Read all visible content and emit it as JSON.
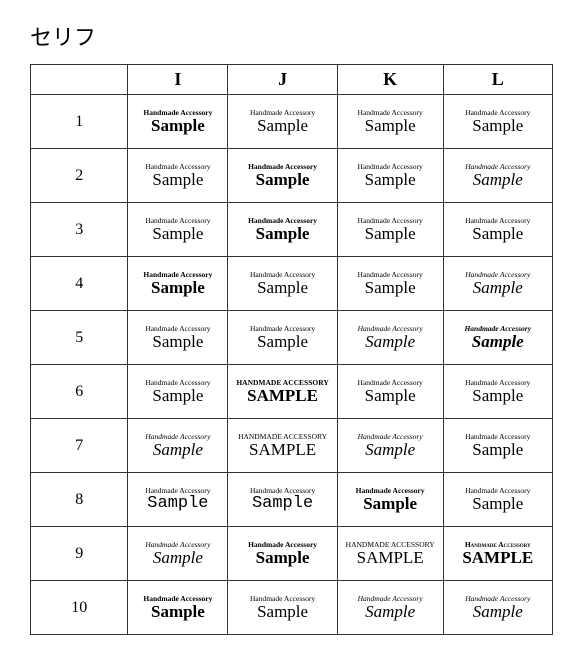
{
  "title": "セリフ",
  "columns": [
    "",
    "I",
    "J",
    "K",
    "L"
  ],
  "rows": [
    {
      "num": "1",
      "cells": [
        {
          "top": "Handmade Accessory",
          "bottom": "Sample",
          "topStyle": "r1i-top",
          "bottomStyle": "r1i-bottom"
        },
        {
          "top": "Handmade Accessory",
          "bottom": "Sample",
          "topStyle": "v-normal",
          "bottomStyle": "v-normal"
        },
        {
          "top": "Handmade Accessory",
          "bottom": "Sample",
          "topStyle": "v-normal",
          "bottomStyle": "v-normal"
        },
        {
          "top": "Handmade Accessory",
          "bottom": "Sample",
          "topStyle": "v-normal",
          "bottomStyle": "v-normal"
        }
      ]
    },
    {
      "num": "2",
      "cells": [
        {
          "top": "Handmade Accessory",
          "bottom": "Sample",
          "topStyle": "v-normal",
          "bottomStyle": "v-normal"
        },
        {
          "top": "Handmade Accessory",
          "bottom": "Sample",
          "topStyle": "v-bold",
          "bottomStyle": "v-bold"
        },
        {
          "top": "Handmade Accessory",
          "bottom": "Sample",
          "topStyle": "v-normal",
          "bottomStyle": "v-normal"
        },
        {
          "top": "Handmade Accessory",
          "bottom": "Sample",
          "topStyle": "v-italic",
          "bottomStyle": "v-italic"
        }
      ]
    },
    {
      "num": "3",
      "cells": [
        {
          "top": "Handmade Accessory",
          "bottom": "Sample",
          "topStyle": "v-normal",
          "bottomStyle": "v-normal"
        },
        {
          "top": "Handmade Accessory",
          "bottom": "Sample",
          "topStyle": "v-bold",
          "bottomStyle": "v-bold"
        },
        {
          "top": "Handmade Accessory",
          "bottom": "Sample",
          "topStyle": "v-normal",
          "bottomStyle": "v-normal"
        },
        {
          "top": "Handmade Accessory",
          "bottom": "Sample",
          "topStyle": "v-normal",
          "bottomStyle": "v-normal"
        }
      ]
    },
    {
      "num": "4",
      "cells": [
        {
          "top": "Handmade Accessory",
          "bottom": "Sample",
          "topStyle": "v-bold",
          "bottomStyle": "v-bold"
        },
        {
          "top": "Handmade Accessory",
          "bottom": "Sample",
          "topStyle": "v-normal",
          "bottomStyle": "v-normal"
        },
        {
          "top": "Handmade Accessory",
          "bottom": "Sample",
          "topStyle": "v-normal",
          "bottomStyle": "v-normal"
        },
        {
          "top": "Handmade Accessory",
          "bottom": "Sample",
          "topStyle": "v-script",
          "bottomStyle": "v-script"
        }
      ]
    },
    {
      "num": "5",
      "cells": [
        {
          "top": "Handmade Accessory",
          "bottom": "Sample",
          "topStyle": "v-normal",
          "bottomStyle": "v-normal"
        },
        {
          "top": "Handmade Accessory",
          "bottom": "Sample",
          "topStyle": "v-normal",
          "bottomStyle": "v-normal"
        },
        {
          "top": "Handmade Accessory",
          "bottom": "Sample",
          "topStyle": "v-script",
          "bottomStyle": "v-script"
        },
        {
          "top": "Handmade Accessory",
          "bottom": "Sample",
          "topStyle": "v-script-bold",
          "bottomStyle": "v-script-bold"
        }
      ]
    },
    {
      "num": "6",
      "cells": [
        {
          "top": "Handmade Accessory",
          "bottom": "Sample",
          "topStyle": "v-normal",
          "bottomStyle": "v-normal"
        },
        {
          "top": "HANDMADE ACCESSORY",
          "bottom": "SAMPLE",
          "topStyle": "v-bold",
          "bottomStyle": "v-bold"
        },
        {
          "top": "Handmade Accessory",
          "bottom": "Sample",
          "topStyle": "v-normal",
          "bottomStyle": "v-normal"
        },
        {
          "top": "Handmade Accessory",
          "bottom": "Sample",
          "topStyle": "v-normal",
          "bottomStyle": "v-normal"
        }
      ]
    },
    {
      "num": "7",
      "cells": [
        {
          "top": "Handmade Accessory",
          "bottom": "Sample",
          "topStyle": "v-script",
          "bottomStyle": "v-script"
        },
        {
          "top": "HANDMADE ACCESSORY",
          "bottom": "SAMPLE",
          "topStyle": "v-smallcaps",
          "bottomStyle": "v-smallcaps"
        },
        {
          "top": "Handmade Accessory",
          "bottom": "Sample",
          "topStyle": "v-script",
          "bottomStyle": "v-script"
        },
        {
          "top": "Handmade Accessory",
          "bottom": "Sample",
          "topStyle": "v-normal",
          "bottomStyle": "v-normal"
        }
      ]
    },
    {
      "num": "8",
      "cells": [
        {
          "top": "Handmade Accessory",
          "bottom": "Sample",
          "topStyle": "v-normal",
          "bottomStyle": "v-mono"
        },
        {
          "top": "Handmade Accessory",
          "bottom": "Sample",
          "topStyle": "v-normal",
          "bottomStyle": "v-mono"
        },
        {
          "top": "Handmade Accessory",
          "bottom": "Sample",
          "topStyle": "v-bold",
          "bottomStyle": "v-bold"
        },
        {
          "top": "Handmade Accessory",
          "bottom": "Sample",
          "topStyle": "v-normal",
          "bottomStyle": "v-normal"
        }
      ]
    },
    {
      "num": "9",
      "cells": [
        {
          "top": "Handmade Accessory",
          "bottom": "Sample",
          "topStyle": "v-script",
          "bottomStyle": "v-script"
        },
        {
          "top": "Handmade Accessory",
          "bottom": "Sample",
          "topStyle": "v-bold",
          "bottomStyle": "v-bold"
        },
        {
          "top": "HANDMADE ACCESSORY",
          "bottom": "SAMPLE",
          "topStyle": "v-smallcaps",
          "bottomStyle": "v-smallcaps"
        },
        {
          "top": "Handmade Accessory",
          "bottom": "SAMPLE",
          "topStyle": "v-smallcaps-bold",
          "bottomStyle": "v-smallcaps-bold"
        }
      ]
    },
    {
      "num": "10",
      "cells": [
        {
          "top": "Handmade Accessory",
          "bottom": "Sample",
          "topStyle": "v-bold",
          "bottomStyle": "v-bold"
        },
        {
          "top": "Handmade Accessory",
          "bottom": "Sample",
          "topStyle": "v-normal",
          "bottomStyle": "v-normal"
        },
        {
          "top": "Handmade Accessory",
          "bottom": "Sample",
          "topStyle": "v-script",
          "bottomStyle": "v-script"
        },
        {
          "top": "Handmade Accessory",
          "bottom": "Sample",
          "topStyle": "v-script",
          "bottomStyle": "v-script"
        }
      ]
    }
  ]
}
